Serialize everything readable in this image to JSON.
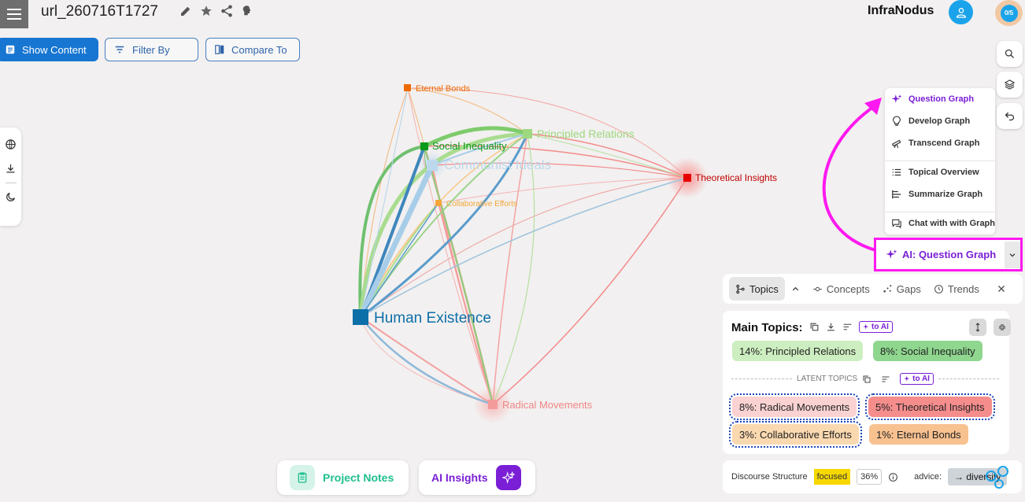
{
  "header": {
    "project_title": "url_260716T1727",
    "brand": "InfraNodus",
    "credits": "0/5"
  },
  "toolbar": {
    "show_content": "Show Content",
    "filter_by": "Filter By",
    "compare_to": "Compare To"
  },
  "graph": {
    "nodes": [
      {
        "label": "Eternal Bonds",
        "color": "#ee6a00"
      },
      {
        "label": "Principled Relations",
        "color": "#8ed46b"
      },
      {
        "label": "Social Inequality",
        "color": "#0a9a1a"
      },
      {
        "label": "Communist Ideals",
        "color": "#b7d7ea"
      },
      {
        "label": "Collaborative Efforts",
        "color": "#f3a73a"
      },
      {
        "label": "Theoretical Insights",
        "color": "#e60000"
      },
      {
        "label": "Human Existence",
        "color": "#0d6fa8"
      },
      {
        "label": "Radical Movements",
        "color": "#f08585"
      }
    ]
  },
  "ai_menu": {
    "items": [
      {
        "label": "Question Graph",
        "icon": "sparkle-icon"
      },
      {
        "label": "Develop Graph",
        "icon": "lightbulb-icon"
      },
      {
        "label": "Transcend Graph",
        "icon": "telescope-icon"
      },
      {
        "label": "Topical Overview",
        "icon": "list-icon"
      },
      {
        "label": "Summarize Graph",
        "icon": "summary-icon"
      },
      {
        "label": "Chat with with Graph",
        "icon": "chat-icon"
      }
    ],
    "button_label": "AI: Question Graph"
  },
  "topics_tabs": {
    "topics": "Topics",
    "concepts": "Concepts",
    "gaps": "Gaps",
    "trends": "Trends"
  },
  "topics_panel": {
    "heading": "Main Topics:",
    "to_ai": "to AI",
    "main_topics": [
      {
        "label": "14%: Principled Relations",
        "color": "#cdeec0"
      },
      {
        "label": "8%: Social Inequality",
        "color": "#8fd68f"
      }
    ],
    "latent_heading": "LATENT TOPICS",
    "latent_topics": [
      {
        "label": "8%: Radical Movements",
        "color": "#fbd2d2"
      },
      {
        "label": "5%: Theoretical Insights",
        "color": "#f58d8d"
      },
      {
        "label": "3%: Collaborative Efforts",
        "color": "#fbd9b0"
      },
      {
        "label": "1%: Eternal Bonds",
        "color": "#f8c190"
      }
    ]
  },
  "discourse": {
    "label": "Discourse Structure",
    "status": "focused",
    "percent": "36%",
    "advice_label": "advice:",
    "advice": "→ diversify"
  },
  "bottom": {
    "project_notes": "Project Notes",
    "ai_insights": "AI Insights"
  }
}
